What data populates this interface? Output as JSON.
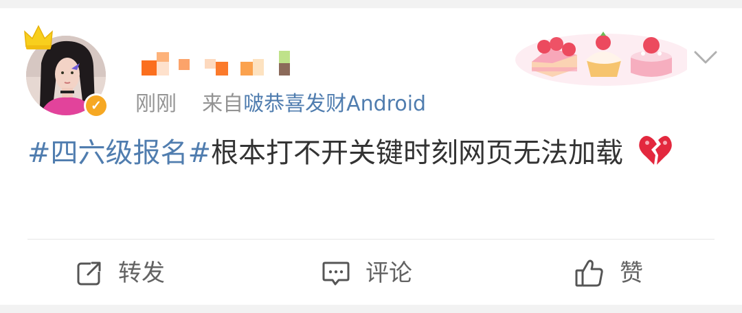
{
  "post": {
    "meta": {
      "time": "刚刚",
      "from_prefix": "来自",
      "source": "啵恭喜发财Android"
    },
    "hashtag": "#四六级报名#",
    "text": "根本打不开关键时刻网页无法加载",
    "emoji": "broken-heart-icon"
  },
  "actions": {
    "repost_label": "转发",
    "comment_label": "评论",
    "like_label": "赞"
  },
  "colors": {
    "link_blue": "#507daf",
    "meta_gray": "#939393",
    "text": "#333333",
    "verified_badge": "#f6a823"
  }
}
